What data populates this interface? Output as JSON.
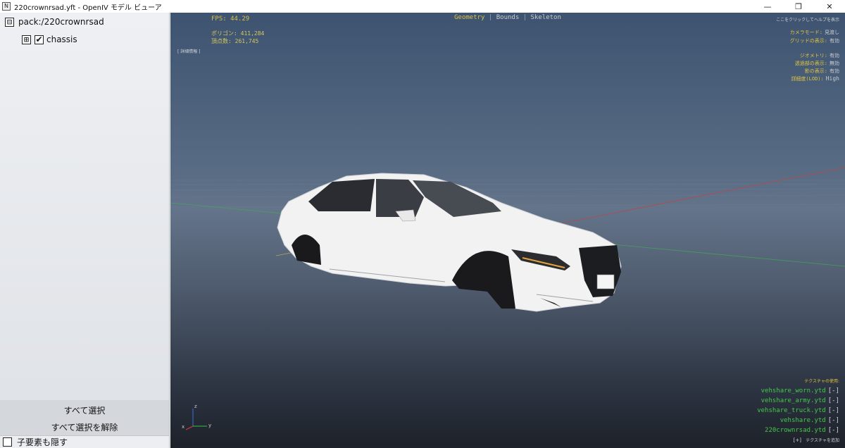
{
  "window": {
    "title": "220crownrsad.yft - OpenIV モデル ビューア",
    "icon": "app-icon",
    "minimize": "—",
    "restore": "❐",
    "close": "✕"
  },
  "tree": {
    "root": {
      "label": "pack:/220crownrsad",
      "expander": "⊟"
    },
    "child": {
      "label": "chassis",
      "expander": "⊞",
      "checked": "✔"
    }
  },
  "panel": {
    "select_all": "すべて選択",
    "deselect_all": "すべて選択を解除",
    "hide_children": "子要素も隠す"
  },
  "viewport": {
    "fps": "FPS: 44.29",
    "polygons": "ポリゴン: 411,284",
    "vertices": "頂点数: 261,745",
    "detail_info": "[ 詳細情報 ]",
    "modes": {
      "geometry": "Geometry",
      "bounds": "Bounds",
      "skeleton": "Skeleton",
      "separator": "|"
    },
    "help": "ここをクリックしてヘルプを表示",
    "settings": [
      {
        "label": "カメラモード:",
        "value": "見渡し"
      },
      {
        "label": "グリッドの表示:",
        "value": "有効"
      },
      {
        "label": "ジオメトリ:",
        "value": "有効"
      },
      {
        "label": "透過部の表示:",
        "value": "無効"
      },
      {
        "label": "影の表示:",
        "value": "有効"
      },
      {
        "label": "詳細度(LOD):",
        "value": "High"
      }
    ],
    "texture_title": "テクスチャの使用:",
    "textures": [
      {
        "name": "vehshare_worn.ytd",
        "action": "[-]"
      },
      {
        "name": "vehshare_army.ytd",
        "action": "[-]"
      },
      {
        "name": "vehshare_truck.ytd",
        "action": "[-]"
      },
      {
        "name": "vehshare.ytd",
        "action": "[-]"
      },
      {
        "name": "220crownrsad.ytd",
        "action": "[-]"
      }
    ],
    "add_texture": {
      "button": "[+]",
      "label": "テクスチャを追加"
    },
    "axis": {
      "z": "z",
      "x": "x",
      "y": "y"
    },
    "colors": {
      "hud_yellow": "#d9c24a",
      "texture_green": "#45c84b",
      "axis_red": "#d83a3a",
      "axis_green": "#3bbf3b",
      "axis_blue": "#3a6fd8"
    }
  }
}
